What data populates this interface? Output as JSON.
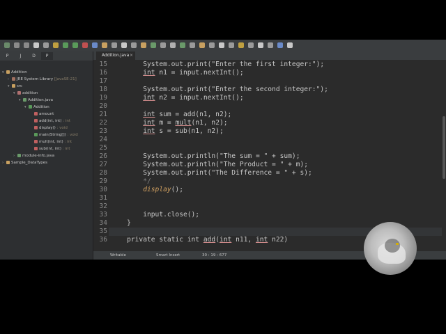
{
  "explorer": {
    "tabs": [
      "P",
      "J",
      "D",
      "P"
    ],
    "tree": [
      {
        "label": "Addition",
        "suffix": "",
        "indent": 0,
        "icon": "project-icon",
        "color": "#c8a060",
        "arrow": "▾"
      },
      {
        "label": "JRE System Library",
        "suffix": "[JavaSE-21]",
        "indent": 1,
        "icon": "library-icon",
        "color": "#a07060",
        "arrow": "›"
      },
      {
        "label": "src",
        "suffix": "",
        "indent": 1,
        "icon": "folder-icon",
        "color": "#c8a060",
        "arrow": "▾"
      },
      {
        "label": "addition",
        "suffix": "",
        "indent": 2,
        "icon": "package-icon",
        "color": "#b07070",
        "arrow": "▾"
      },
      {
        "label": "Addition.java",
        "suffix": "",
        "indent": 3,
        "icon": "java-file-icon",
        "color": "#6a9a6a",
        "arrow": "▾"
      },
      {
        "label": "Addition",
        "suffix": "",
        "indent": 4,
        "icon": "class-icon",
        "color": "#5a9a5a",
        "arrow": "▾"
      },
      {
        "label": "amount",
        "suffix": "",
        "indent": 5,
        "icon": "field-icon",
        "color": "#c06060",
        "arrow": ""
      },
      {
        "label": "add(int, int)",
        "suffix": ": int",
        "indent": 5,
        "icon": "method-icon",
        "color": "#c06060",
        "arrow": ""
      },
      {
        "label": "display()",
        "suffix": ": void",
        "indent": 5,
        "icon": "method-icon",
        "color": "#c06060",
        "arrow": ""
      },
      {
        "label": "main(String[])",
        "suffix": ": void",
        "indent": 5,
        "icon": "method-icon",
        "color": "#5a9a5a",
        "arrow": ""
      },
      {
        "label": "mult(int, int)",
        "suffix": ": int",
        "indent": 5,
        "icon": "method-icon",
        "color": "#c06060",
        "arrow": ""
      },
      {
        "label": "sub(int, int)",
        "suffix": ": int",
        "indent": 5,
        "icon": "method-icon",
        "color": "#c06060",
        "arrow": ""
      },
      {
        "label": "module-info.java",
        "suffix": "",
        "indent": 2,
        "icon": "java-file-icon",
        "color": "#6a9a6a",
        "arrow": "›"
      },
      {
        "label": "Sample_DataTypes",
        "suffix": "",
        "indent": 0,
        "icon": "project-icon",
        "color": "#c8a060",
        "arrow": "›"
      }
    ]
  },
  "editor": {
    "tab_label": "Addition.java",
    "close_label": "×",
    "line_numbers": [
      "15",
      "16",
      "17",
      "18",
      "19",
      "20",
      "21",
      "22",
      "23",
      "24",
      "25",
      "26",
      "27",
      "28",
      "29",
      "30",
      "31",
      "32",
      "33",
      "34",
      "35",
      "36"
    ],
    "lines": [
      {
        "indent": "        ",
        "parts": [
          {
            "t": "System.out.print(\"Enter the first integer:\");",
            "c": ""
          }
        ]
      },
      {
        "indent": "        ",
        "parts": [
          {
            "t": "int",
            "c": "ul"
          },
          {
            "t": " n1 = input.nextInt();",
            "c": ""
          }
        ]
      },
      {
        "indent": "",
        "parts": []
      },
      {
        "indent": "        ",
        "parts": [
          {
            "t": "System.out.print(\"Enter the second integer:\");",
            "c": ""
          }
        ]
      },
      {
        "indent": "        ",
        "parts": [
          {
            "t": "int",
            "c": "ul"
          },
          {
            "t": " n2 = input.nextInt();",
            "c": ""
          }
        ]
      },
      {
        "indent": "",
        "parts": []
      },
      {
        "indent": "        ",
        "parts": [
          {
            "t": "int",
            "c": "ul"
          },
          {
            "t": " sum = add(n1, n2);",
            "c": ""
          }
        ]
      },
      {
        "indent": "        ",
        "parts": [
          {
            "t": "int",
            "c": "ul"
          },
          {
            "t": " m = ",
            "c": ""
          },
          {
            "t": "mult",
            "c": "ul"
          },
          {
            "t": "(n1, n2);",
            "c": ""
          }
        ]
      },
      {
        "indent": "        ",
        "parts": [
          {
            "t": "int",
            "c": "ul"
          },
          {
            "t": " s = sub(n1, n2);",
            "c": ""
          }
        ]
      },
      {
        "indent": "",
        "parts": []
      },
      {
        "indent": "",
        "parts": []
      },
      {
        "indent": "        ",
        "parts": [
          {
            "t": "System.out.println(\"The sum = \" + sum);",
            "c": ""
          }
        ]
      },
      {
        "indent": "        ",
        "parts": [
          {
            "t": "System.out.println(\"The Product = \" + m);",
            "c": ""
          }
        ]
      },
      {
        "indent": "        ",
        "parts": [
          {
            "t": "System.out.print(\"The Difference = \" + s);",
            "c": ""
          }
        ]
      },
      {
        "indent": "        ",
        "parts": [
          {
            "t": "*/",
            "c": "cm"
          }
        ]
      },
      {
        "indent": "        ",
        "parts": [
          {
            "t": "display",
            "c": "ital"
          },
          {
            "t": "();",
            "c": ""
          }
        ]
      },
      {
        "indent": "",
        "parts": []
      },
      {
        "indent": "",
        "parts": []
      },
      {
        "indent": "        ",
        "parts": [
          {
            "t": "input.close();",
            "c": ""
          }
        ]
      },
      {
        "indent": "    ",
        "parts": [
          {
            "t": "}",
            "c": ""
          }
        ]
      },
      {
        "indent": "",
        "parts": []
      },
      {
        "indent": "    ",
        "parts": [
          {
            "t": "private static int ",
            "c": ""
          },
          {
            "t": "add",
            "c": "ul"
          },
          {
            "t": "(",
            "c": ""
          },
          {
            "t": "int",
            "c": "ul"
          },
          {
            "t": " n11, ",
            "c": ""
          },
          {
            "t": "int",
            "c": "ul"
          },
          {
            "t": " n22)",
            "c": ""
          }
        ]
      }
    ]
  },
  "status": {
    "writable": "Writable",
    "insert_mode": "Smart Insert",
    "position": "30 : 19 : 677"
  }
}
